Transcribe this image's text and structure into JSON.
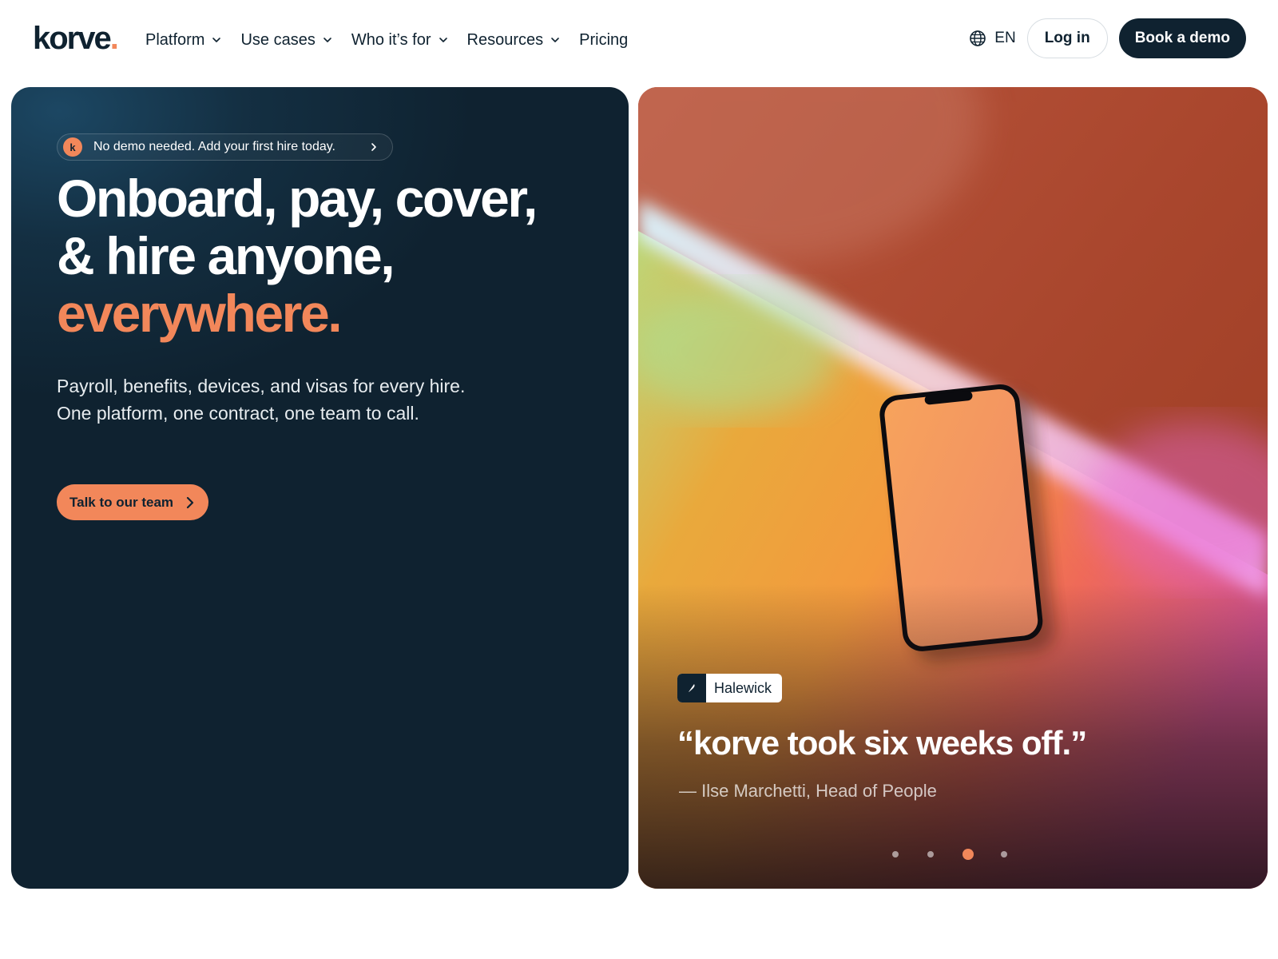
{
  "brand": {
    "logo_text": "korve",
    "logo_dot": ".",
    "accent_color": "#f2875a",
    "dark_color": "#0f2230"
  },
  "nav": {
    "items": [
      {
        "label": "Platform",
        "has_dropdown": true
      },
      {
        "label": "Use cases",
        "has_dropdown": true
      },
      {
        "label": "Who it’s for",
        "has_dropdown": true
      },
      {
        "label": "Resources",
        "has_dropdown": true
      },
      {
        "label": "Pricing",
        "has_dropdown": false
      }
    ]
  },
  "header_actions": {
    "language_icon": "globe-icon",
    "language": "EN",
    "login_label": "Log in",
    "demo_label": "Book a demo"
  },
  "hero": {
    "pill_badge": "k",
    "pill_text": "No demo needed. Add your first hire today.",
    "headline_line1": "Onboard, pay, cover,",
    "headline_line2": "& hire anyone,",
    "headline_accent": "everywhere.",
    "subtext_line1": "Payroll, benefits, devices, and visas for every hire.",
    "subtext_line2": "One platform, one contract, one team to call.",
    "cta_label": "Talk to our team"
  },
  "testimonial": {
    "company_icon": "feather-icon",
    "company": "Halewick",
    "quote": "“korve took six weeks off.”",
    "attribution": "— Ilse Marchetti, Head of People",
    "carousel": {
      "total_slides": 4,
      "active_slide": 3
    }
  }
}
